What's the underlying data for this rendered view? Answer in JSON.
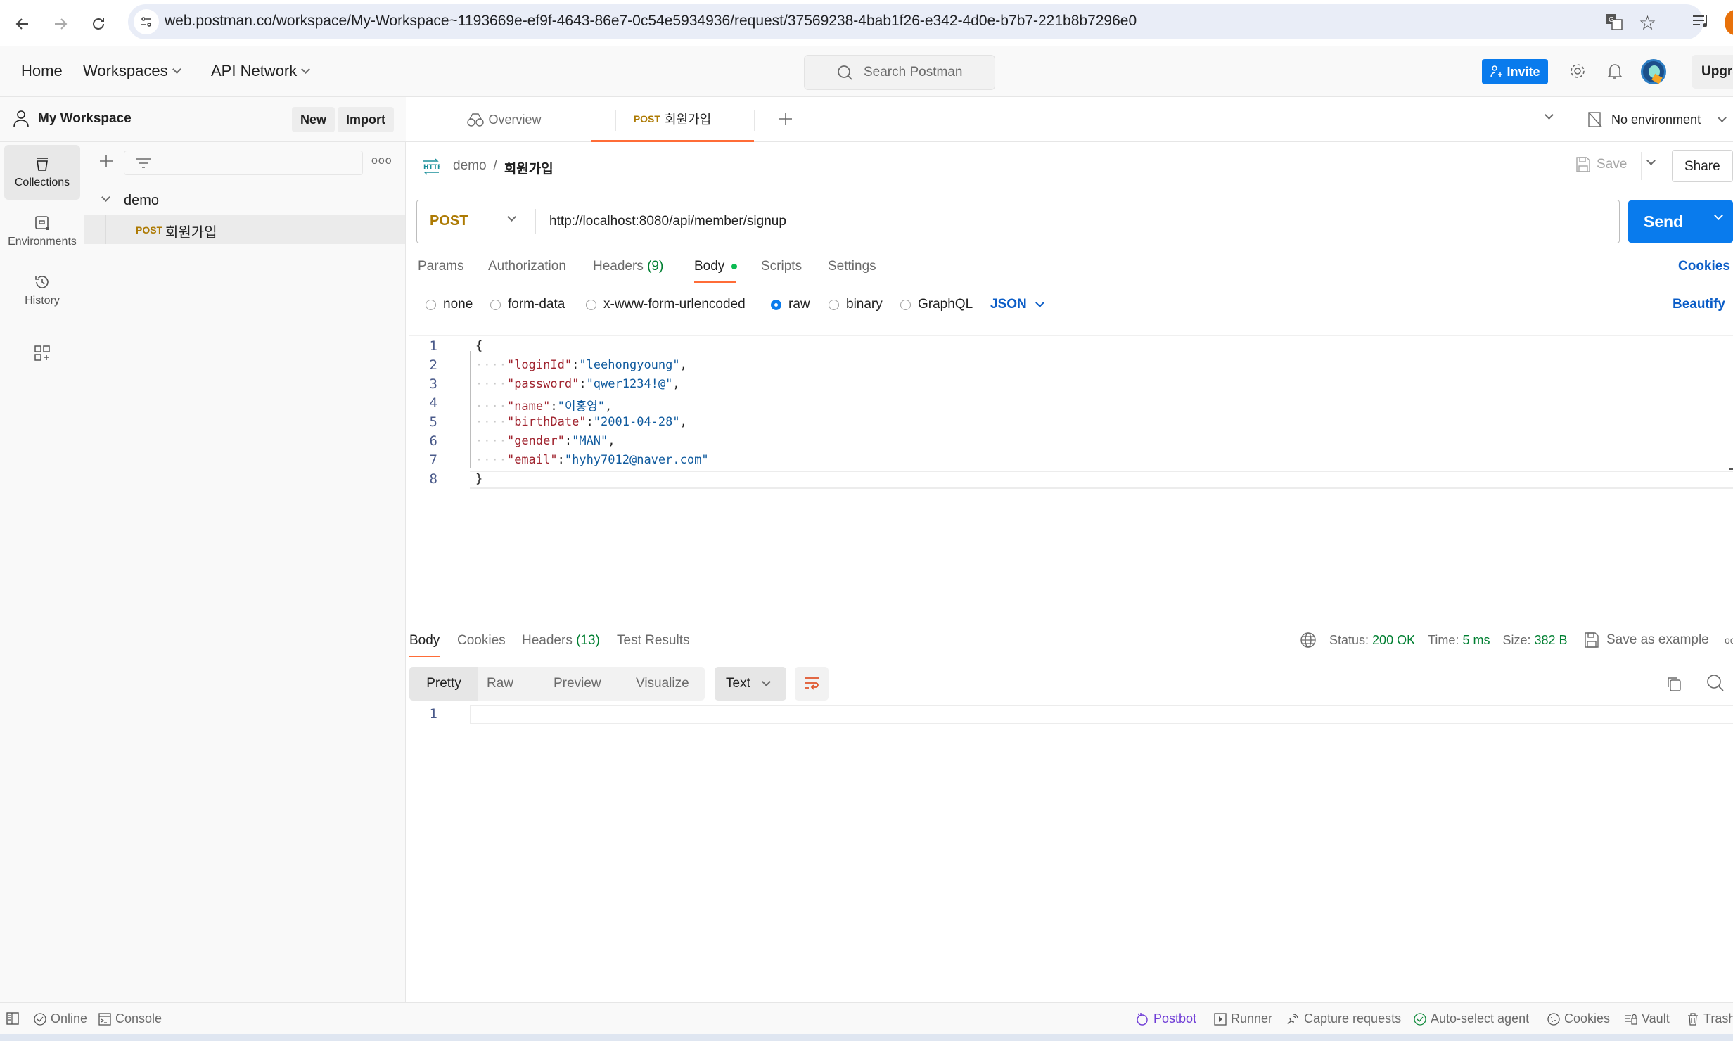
{
  "browser": {
    "url": "web.postman.co/workspace/My-Workspace~1193669e-ef9f-4643-86e7-0c54e5934936/request/37569238-4bab1f26-e342-4d0e-b7b7-221b8b7296e0"
  },
  "header": {
    "home": "Home",
    "workspaces": "Workspaces",
    "api_network": "API Network",
    "search_placeholder": "Search Postman",
    "invite": "Invite",
    "upgrade": "Upgrade"
  },
  "workspace": {
    "name": "My Workspace",
    "new_label": "New",
    "import_label": "Import"
  },
  "rail": {
    "items": [
      {
        "label": "Collections",
        "icon": "collections-icon",
        "active": true
      },
      {
        "label": "Environments",
        "icon": "environments-icon"
      },
      {
        "label": "History",
        "icon": "history-icon"
      }
    ]
  },
  "collections": {
    "tree": [
      {
        "name": "demo",
        "expanded": true,
        "requests": [
          {
            "method": "POST",
            "name": "회원가입"
          }
        ]
      }
    ]
  },
  "tabs": {
    "overview": "Overview",
    "active": {
      "method": "POST",
      "name": "회원가입"
    },
    "environment": "No environment"
  },
  "request": {
    "breadcrumb": {
      "collection": "demo",
      "separator": "/",
      "name": "회원가입"
    },
    "save": "Save",
    "share": "Share",
    "method": "POST",
    "url": "http://localhost:8080/api/member/signup",
    "send": "Send",
    "tabs": [
      {
        "label": "Params"
      },
      {
        "label": "Authorization"
      },
      {
        "label": "Headers",
        "count": "(9)"
      },
      {
        "label": "Body",
        "active": true
      },
      {
        "label": "Scripts"
      },
      {
        "label": "Settings"
      }
    ],
    "cookies": "Cookies",
    "body_types": [
      "none",
      "form-data",
      "x-www-form-urlencoded",
      "raw",
      "binary",
      "GraphQL"
    ],
    "body_type_selected": "raw",
    "language": "JSON",
    "beautify": "Beautify",
    "body_lines": [
      {
        "n": "1",
        "text": "{"
      },
      {
        "n": "2",
        "key": "\"loginId\"",
        "value": "\"leehongyoung\"",
        "comma": ","
      },
      {
        "n": "3",
        "key": "\"password\"",
        "value": "\"qwer1234!@\"",
        "comma": ","
      },
      {
        "n": "4",
        "key": "\"name\"",
        "value": "\"이홍영\"",
        "comma": ","
      },
      {
        "n": "5",
        "key": "\"birthDate\"",
        "value": "\"2001-04-28\"",
        "comma": ","
      },
      {
        "n": "6",
        "key": "\"gender\"",
        "value": "\"MAN\"",
        "comma": ","
      },
      {
        "n": "7",
        "key": "\"email\"",
        "value": "\"hyhy7012@naver.com\"",
        "comma": ""
      },
      {
        "n": "8",
        "text": "}"
      }
    ]
  },
  "response": {
    "tabs": [
      {
        "label": "Body",
        "active": true
      },
      {
        "label": "Cookies"
      },
      {
        "label": "Headers",
        "count": "(13)"
      },
      {
        "label": "Test Results"
      }
    ],
    "status_label": "Status:",
    "status": "200 OK",
    "time_label": "Time:",
    "time": "5 ms",
    "size_label": "Size:",
    "size": "382 B",
    "save_example": "Save as example",
    "views": [
      "Pretty",
      "Raw",
      "Preview",
      "Visualize"
    ],
    "view_selected": "Pretty",
    "format": "Text",
    "line_number": "1"
  },
  "footer": {
    "online": "Online",
    "console": "Console",
    "postbot": "Postbot",
    "runner": "Runner",
    "capture": "Capture requests",
    "agent": "Auto-select agent",
    "cookies": "Cookies",
    "vault": "Vault",
    "trash": "Trash"
  },
  "colors": {
    "accent": "#ff6c37",
    "primary": "#097bed",
    "post": "#ad7a03",
    "success": "#007f31"
  }
}
